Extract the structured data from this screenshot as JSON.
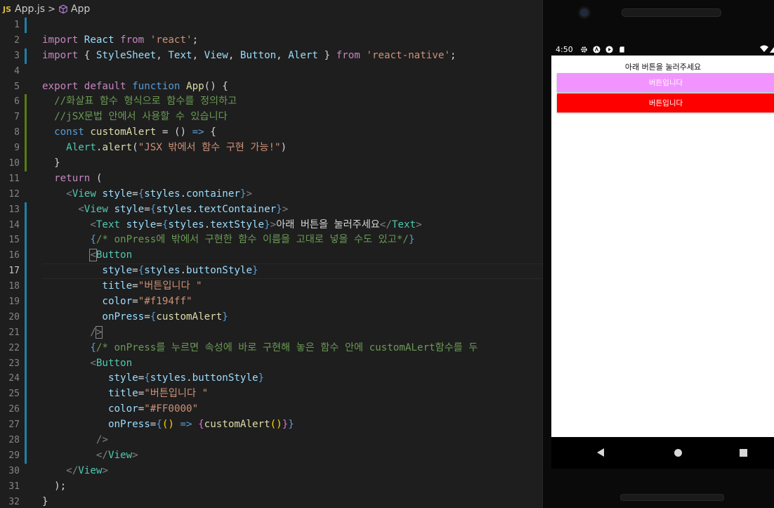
{
  "breadcrumb": {
    "file_badge": "JS",
    "file": "App.js",
    "separator": ">",
    "symbol": "App"
  },
  "colors": {
    "button1": "#f194ff",
    "button2": "#FF0000",
    "string": "#ce9178",
    "comment": "#6a9955"
  },
  "code_lines": [
    {
      "n": "1",
      "parts": []
    },
    {
      "n": "2",
      "parts": [
        {
          "t": "import",
          "c": "k"
        },
        {
          "t": " React ",
          "c": "v"
        },
        {
          "t": "from",
          "c": "k"
        },
        {
          "t": " ",
          "c": "o"
        },
        {
          "t": "'react'",
          "c": "s"
        },
        {
          "t": ";",
          "c": "o"
        }
      ]
    },
    {
      "n": "3",
      "parts": [
        {
          "t": "import",
          "c": "k"
        },
        {
          "t": " { ",
          "c": "o"
        },
        {
          "t": "StyleSheet",
          "c": "v"
        },
        {
          "t": ", ",
          "c": "o"
        },
        {
          "t": "Text",
          "c": "v"
        },
        {
          "t": ", ",
          "c": "o"
        },
        {
          "t": "View",
          "c": "v"
        },
        {
          "t": ", ",
          "c": "o"
        },
        {
          "t": "Button",
          "c": "v"
        },
        {
          "t": ", ",
          "c": "o"
        },
        {
          "t": "Alert",
          "c": "v"
        },
        {
          "t": " } ",
          "c": "o"
        },
        {
          "t": "from",
          "c": "k"
        },
        {
          "t": " ",
          "c": "o"
        },
        {
          "t": "'react-native'",
          "c": "s"
        },
        {
          "t": ";",
          "c": "o"
        }
      ]
    },
    {
      "n": "4",
      "parts": []
    },
    {
      "n": "5",
      "parts": [
        {
          "t": "export",
          "c": "k"
        },
        {
          "t": " ",
          "c": "o"
        },
        {
          "t": "default",
          "c": "k"
        },
        {
          "t": " ",
          "c": "o"
        },
        {
          "t": "function",
          "c": "b"
        },
        {
          "t": " ",
          "c": "o"
        },
        {
          "t": "App",
          "c": "f"
        },
        {
          "t": "() {",
          "c": "o"
        }
      ]
    },
    {
      "n": "6",
      "parts": [
        {
          "t": "  //화살표 함수 형식으로 함수를 정의하고",
          "c": "cm"
        }
      ]
    },
    {
      "n": "7",
      "parts": [
        {
          "t": "  //jSX문법 안에서 사용할 수 있습니다",
          "c": "cm"
        }
      ]
    },
    {
      "n": "8",
      "parts": [
        {
          "t": "  ",
          "c": "o"
        },
        {
          "t": "const",
          "c": "b"
        },
        {
          "t": " ",
          "c": "o"
        },
        {
          "t": "customAlert",
          "c": "f"
        },
        {
          "t": " = () ",
          "c": "o"
        },
        {
          "t": "=>",
          "c": "b"
        },
        {
          "t": " {",
          "c": "o"
        }
      ]
    },
    {
      "n": "9",
      "parts": [
        {
          "t": "    ",
          "c": "o"
        },
        {
          "t": "Alert",
          "c": "t"
        },
        {
          "t": ".",
          "c": "o"
        },
        {
          "t": "alert",
          "c": "f"
        },
        {
          "t": "(",
          "c": "o"
        },
        {
          "t": "\"JSX 밖에서 함수 구현 가능!\"",
          "c": "s"
        },
        {
          "t": ")",
          "c": "o"
        }
      ]
    },
    {
      "n": "10",
      "parts": [
        {
          "t": "  }",
          "c": "o"
        }
      ]
    },
    {
      "n": "11",
      "parts": [
        {
          "t": "  ",
          "c": "o"
        },
        {
          "t": "return",
          "c": "k"
        },
        {
          "t": " (",
          "c": "o"
        }
      ]
    },
    {
      "n": "12",
      "parts": [
        {
          "t": "    ",
          "c": "o"
        },
        {
          "t": "<",
          "c": "p"
        },
        {
          "t": "View",
          "c": "t"
        },
        {
          "t": " ",
          "c": "o"
        },
        {
          "t": "style",
          "c": "v"
        },
        {
          "t": "=",
          "c": "o"
        },
        {
          "t": "{",
          "c": "b"
        },
        {
          "t": "styles",
          "c": "v"
        },
        {
          "t": ".",
          "c": "o"
        },
        {
          "t": "container",
          "c": "v"
        },
        {
          "t": "}",
          "c": "b"
        },
        {
          "t": ">",
          "c": "p"
        }
      ]
    },
    {
      "n": "13",
      "parts": [
        {
          "t": "      ",
          "c": "o"
        },
        {
          "t": "<",
          "c": "p"
        },
        {
          "t": "View",
          "c": "t"
        },
        {
          "t": " ",
          "c": "o"
        },
        {
          "t": "style",
          "c": "v"
        },
        {
          "t": "=",
          "c": "o"
        },
        {
          "t": "{",
          "c": "b"
        },
        {
          "t": "styles",
          "c": "v"
        },
        {
          "t": ".",
          "c": "o"
        },
        {
          "t": "textContainer",
          "c": "v"
        },
        {
          "t": "}",
          "c": "b"
        },
        {
          "t": ">",
          "c": "p"
        }
      ]
    },
    {
      "n": "14",
      "parts": [
        {
          "t": "        ",
          "c": "o"
        },
        {
          "t": "<",
          "c": "p"
        },
        {
          "t": "Text",
          "c": "t"
        },
        {
          "t": " ",
          "c": "o"
        },
        {
          "t": "style",
          "c": "v"
        },
        {
          "t": "=",
          "c": "o"
        },
        {
          "t": "{",
          "c": "b"
        },
        {
          "t": "styles",
          "c": "v"
        },
        {
          "t": ".",
          "c": "o"
        },
        {
          "t": "textStyle",
          "c": "v"
        },
        {
          "t": "}",
          "c": "b"
        },
        {
          "t": ">",
          "c": "p"
        },
        {
          "t": "아래 버튼을 눌러주세요",
          "c": "o"
        },
        {
          "t": "</",
          "c": "p"
        },
        {
          "t": "Text",
          "c": "t"
        },
        {
          "t": ">",
          "c": "p"
        }
      ]
    },
    {
      "n": "15",
      "parts": [
        {
          "t": "        ",
          "c": "o"
        },
        {
          "t": "{",
          "c": "b"
        },
        {
          "t": "/* onPress에 밖에서 구현한 함수 이름을 고대로 넣을 수도 있고*/",
          "c": "cm"
        },
        {
          "t": "}",
          "c": "b"
        }
      ]
    },
    {
      "n": "16",
      "parts": [
        {
          "t": "        ",
          "c": "o"
        },
        {
          "t": "<",
          "c": "p",
          "box": true
        },
        {
          "t": "Button",
          "c": "t"
        }
      ]
    },
    {
      "n": "17",
      "parts": [
        {
          "t": "          ",
          "c": "o"
        },
        {
          "t": "style",
          "c": "v"
        },
        {
          "t": "=",
          "c": "o"
        },
        {
          "t": "{",
          "c": "b"
        },
        {
          "t": "styles",
          "c": "v"
        },
        {
          "t": ".",
          "c": "o"
        },
        {
          "t": "buttonStyle",
          "c": "v"
        },
        {
          "t": "}",
          "c": "b"
        }
      ]
    },
    {
      "n": "18",
      "parts": [
        {
          "t": "          ",
          "c": "o"
        },
        {
          "t": "title",
          "c": "v"
        },
        {
          "t": "=",
          "c": "o"
        },
        {
          "t": "\"버튼입니다 \"",
          "c": "s"
        }
      ]
    },
    {
      "n": "19",
      "parts": [
        {
          "t": "          ",
          "c": "o"
        },
        {
          "t": "color",
          "c": "v"
        },
        {
          "t": "=",
          "c": "o"
        },
        {
          "t": "\"#f194ff\"",
          "c": "s"
        }
      ]
    },
    {
      "n": "20",
      "parts": [
        {
          "t": "          ",
          "c": "o"
        },
        {
          "t": "onPress",
          "c": "v"
        },
        {
          "t": "=",
          "c": "o"
        },
        {
          "t": "{",
          "c": "b"
        },
        {
          "t": "customAlert",
          "c": "f"
        },
        {
          "t": "}",
          "c": "b"
        }
      ]
    },
    {
      "n": "21",
      "parts": [
        {
          "t": "        ",
          "c": "o"
        },
        {
          "t": "/",
          "c": "p"
        },
        {
          "t": ">",
          "c": "p",
          "box": true
        }
      ]
    },
    {
      "n": "22",
      "parts": [
        {
          "t": "        ",
          "c": "o"
        },
        {
          "t": "{",
          "c": "b"
        },
        {
          "t": "/* onPress를 누르면 속성에 바로 구현해 놓은 함수 안에 customALert함수를 두",
          "c": "cm"
        }
      ]
    },
    {
      "n": "23",
      "parts": [
        {
          "t": "        ",
          "c": "o"
        },
        {
          "t": "<",
          "c": "p"
        },
        {
          "t": "Button",
          "c": "t"
        }
      ]
    },
    {
      "n": "24",
      "parts": [
        {
          "t": "           ",
          "c": "o"
        },
        {
          "t": "style",
          "c": "v"
        },
        {
          "t": "=",
          "c": "o"
        },
        {
          "t": "{",
          "c": "b"
        },
        {
          "t": "styles",
          "c": "v"
        },
        {
          "t": ".",
          "c": "o"
        },
        {
          "t": "buttonStyle",
          "c": "v"
        },
        {
          "t": "}",
          "c": "b"
        }
      ]
    },
    {
      "n": "25",
      "parts": [
        {
          "t": "           ",
          "c": "o"
        },
        {
          "t": "title",
          "c": "v"
        },
        {
          "t": "=",
          "c": "o"
        },
        {
          "t": "\"버튼입니다 \"",
          "c": "s"
        }
      ]
    },
    {
      "n": "26",
      "parts": [
        {
          "t": "           ",
          "c": "o"
        },
        {
          "t": "color",
          "c": "v"
        },
        {
          "t": "=",
          "c": "o"
        },
        {
          "t": "\"#FF0000\"",
          "c": "s"
        }
      ]
    },
    {
      "n": "27",
      "parts": [
        {
          "t": "           ",
          "c": "o"
        },
        {
          "t": "onPress",
          "c": "v"
        },
        {
          "t": "=",
          "c": "o"
        },
        {
          "t": "{",
          "c": "b"
        },
        {
          "t": "() ",
          "c": "y"
        },
        {
          "t": "=>",
          "c": "b"
        },
        {
          "t": " {",
          "c": "m"
        },
        {
          "t": "customAlert",
          "c": "f"
        },
        {
          "t": "()",
          "c": "y"
        },
        {
          "t": "}",
          "c": "m"
        },
        {
          "t": "}",
          "c": "b"
        }
      ]
    },
    {
      "n": "28",
      "parts": [
        {
          "t": "         ",
          "c": "o"
        },
        {
          "t": "/>",
          "c": "p"
        }
      ]
    },
    {
      "n": "29",
      "parts": [
        {
          "t": "         ",
          "c": "o"
        },
        {
          "t": "</",
          "c": "p"
        },
        {
          "t": "View",
          "c": "t"
        },
        {
          "t": ">",
          "c": "p"
        }
      ]
    },
    {
      "n": "30",
      "parts": [
        {
          "t": "    ",
          "c": "o"
        },
        {
          "t": "</",
          "c": "p"
        },
        {
          "t": "View",
          "c": "t"
        },
        {
          "t": ">",
          "c": "p"
        }
      ]
    },
    {
      "n": "31",
      "parts": [
        {
          "t": "  );",
          "c": "o"
        }
      ]
    },
    {
      "n": "32",
      "parts": [
        {
          "t": "}",
          "c": "o"
        }
      ]
    }
  ],
  "phone": {
    "status_time": "4:50",
    "status_icons": [
      "gear-icon",
      "a-icon",
      "play-icon",
      "sd-card-icon"
    ],
    "status_right_icons": [
      "wifi-icon",
      "signal-icon"
    ],
    "header_text": "아래 버튼을 눌러주세요",
    "button1_label": "버튼입니다",
    "button2_label": "버튼입니다",
    "nav": [
      "back-icon",
      "home-icon",
      "recents-icon"
    ]
  }
}
